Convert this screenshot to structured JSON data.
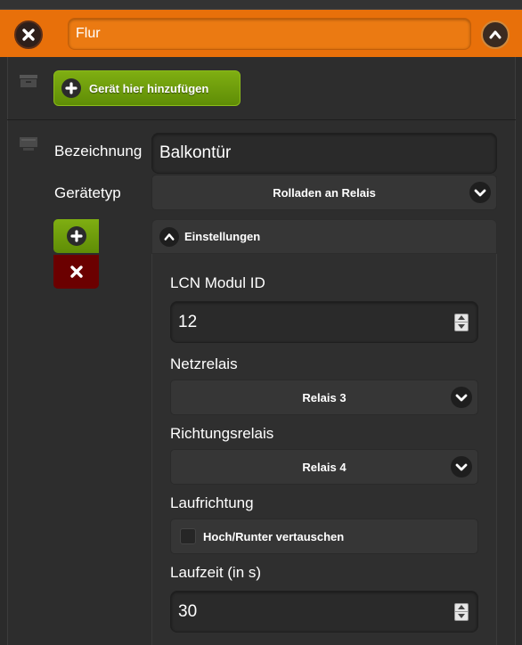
{
  "header": {
    "room_name": "Flur"
  },
  "toolbar": {
    "add_device_label": "Gerät hier hinzufügen"
  },
  "device": {
    "name_label": "Bezeichnung",
    "name_value": "Balkontür",
    "type_label": "Gerätetyp",
    "type_value": "Rolladen an Relais"
  },
  "settings": {
    "toggle_label": "Einstellungen",
    "lcn_module_id_label": "LCN Modul ID",
    "lcn_module_id_value": "12",
    "power_relay_label": "Netzrelais",
    "power_relay_value": "Relais 3",
    "direction_relay_label": "Richtungsrelais",
    "direction_relay_value": "Relais 4",
    "run_direction_label": "Laufrichtung",
    "swap_label": "Hoch/Runter vertauschen",
    "run_time_label": "Laufzeit (in s)",
    "run_time_value": "30"
  },
  "colors": {
    "header_orange": "#e8700a",
    "add_green": "#6e9e0c",
    "remove_red": "#6b0000",
    "background": "#2b2b2b"
  },
  "icons": {
    "close": "close-icon",
    "collapse": "chevron-up-icon",
    "plus": "plus-icon",
    "remove": "close-icon",
    "dropdown": "chevron-down-icon",
    "room_box": "archive-box-icon",
    "device": "device-icon"
  }
}
